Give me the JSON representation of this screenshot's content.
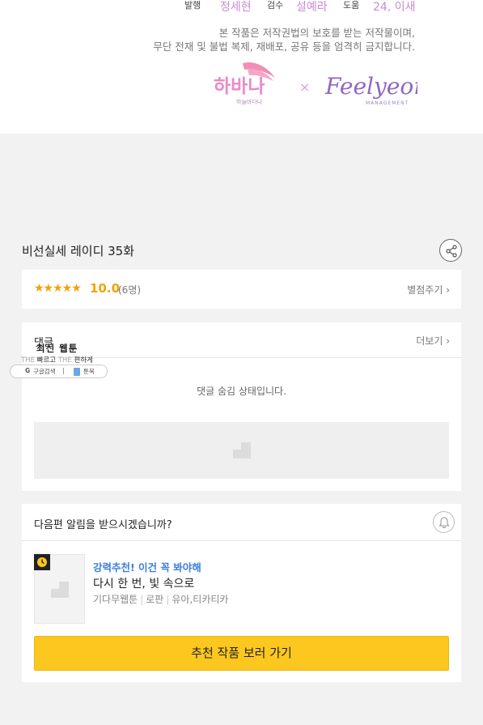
{
  "credits": {
    "publisher_label": "발행",
    "publisher": "정세현",
    "review_label": "검수",
    "reviewer": "설예라",
    "assist_label": "도움",
    "assistant": "24, 이새",
    "copyright_line1": "본 작품은 저작권법의 보호를 받는 저작물이며,",
    "copyright_line2": "무단 전재 및 불법 복제, 재배포, 공유 등을 엄격히 금지합니다.",
    "logo_left_text": "하바나",
    "logo_left_sub": "하늘바다나",
    "logo_right_text": "Feelyeon",
    "logo_right_sub": "MANAGEMENT",
    "logo_separator": "×"
  },
  "episode": {
    "title": "비선실세 레이디 35화"
  },
  "rating": {
    "stars": "★★★★★",
    "score": "10.0",
    "count": "(6명)",
    "rate_link": "별점주기 ›"
  },
  "comments": {
    "title": "댓글",
    "more": "더보기 ›",
    "hidden_message": "댓글 숨김 상태입니다."
  },
  "overlay": {
    "title": "최신 웹툰",
    "sub_the1": "THE",
    "sub_fast": "빠르고",
    "sub_the2": "THE",
    "sub_easy": "편하게",
    "google_icon": "G",
    "google_text": "구글검색",
    "separator": "|",
    "site_text": "툰북"
  },
  "notify": {
    "question": "다음편 알림을 받으시겠습니까?",
    "rec_label": "강력추천! 이건 꼭 봐야해",
    "rec_title": "다시 한 번, 빛 속으로",
    "rec_meta_1": "기다무웹툰",
    "rec_meta_2": "로판",
    "rec_meta_3": "유아,티카티카",
    "meta_separator": "|",
    "button": "추천 작품 보러 가기"
  },
  "colors": {
    "accent_star": "#f0a30a",
    "recommend_blue": "#3b7fd8",
    "button_yellow": "#fcc81f",
    "credit_pink": "#c98bd0"
  },
  "icons": {
    "share": "share-icon",
    "bell": "bell-icon",
    "clock": "clock-icon",
    "image_placeholder": "image-placeholder-icon"
  }
}
